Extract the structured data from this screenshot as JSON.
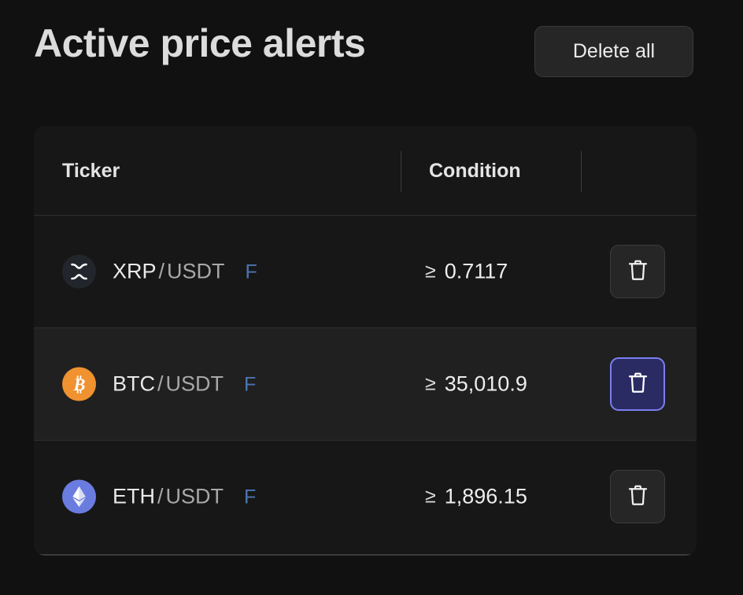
{
  "header": {
    "title": "Active price alerts",
    "delete_all_label": "Delete all"
  },
  "table": {
    "columns": [
      "Ticker",
      "Condition",
      ""
    ],
    "rows": [
      {
        "icon": "xrp-coin-icon",
        "base": "XRP",
        "separator": "/",
        "quote": "USDT",
        "market_flag": "F",
        "condition_operator": "≥",
        "condition_value": "0.7117",
        "delete_label": "trash-icon",
        "hovered": false,
        "focused": false
      },
      {
        "icon": "btc-coin-icon",
        "base": "BTC",
        "separator": "/",
        "quote": "USDT",
        "market_flag": "F",
        "condition_operator": "≥",
        "condition_value": "35,010.9",
        "delete_label": "trash-icon",
        "hovered": true,
        "focused": true
      },
      {
        "icon": "eth-coin-icon",
        "base": "ETH",
        "separator": "/",
        "quote": "USDT",
        "market_flag": "F",
        "condition_operator": "≥",
        "condition_value": "1,896.15",
        "delete_label": "trash-icon",
        "hovered": false,
        "focused": false
      }
    ]
  },
  "colors": {
    "page_background": "#111111",
    "card_background": "#171717",
    "row_hover_background": "#202020",
    "button_background": "#262626",
    "button_border": "#3a3a3a",
    "focus_background": "#2b2b63",
    "focus_border": "#7a7ff0",
    "market_flag": "#4d75b0",
    "btc_orange": "#ef922f",
    "eth_blue": "#6a7ce0",
    "xrp_dark": "#22262c",
    "text_primary": "#e9e9e9",
    "text_muted": "#a8a8a8",
    "divider": "#2e2e2e"
  }
}
